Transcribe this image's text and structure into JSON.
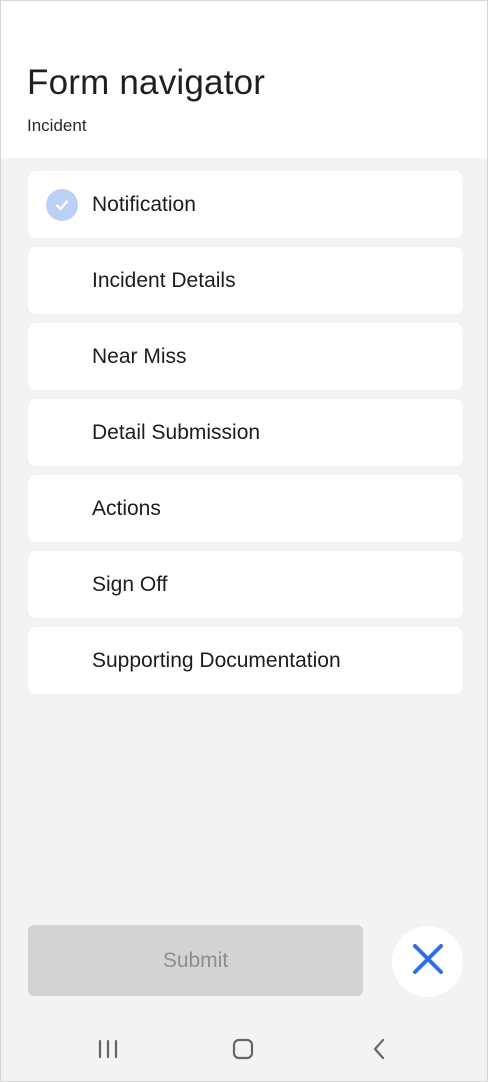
{
  "header": {
    "title": "Form navigator",
    "subtitle": "Incident"
  },
  "sections": [
    {
      "label": "Notification",
      "completed": true
    },
    {
      "label": "Incident Details",
      "completed": false
    },
    {
      "label": "Near Miss",
      "completed": false
    },
    {
      "label": "Detail Submission",
      "completed": false
    },
    {
      "label": "Actions",
      "completed": false
    },
    {
      "label": "Sign Off",
      "completed": false
    },
    {
      "label": "Supporting Documentation",
      "completed": false
    }
  ],
  "footer": {
    "submit_label": "Submit",
    "submit_enabled": false,
    "close_icon": "close-icon"
  },
  "system_nav": {
    "recents_icon": "recents-icon",
    "home_icon": "home-icon",
    "back_icon": "back-icon"
  },
  "colors": {
    "accent": "#2f6fe4",
    "check_bg": "#bcd0f5",
    "page_bg": "#f3f3f3",
    "card_bg": "#ffffff",
    "submit_disabled_bg": "#d3d3d3",
    "submit_disabled_text": "#8e8e8e"
  }
}
